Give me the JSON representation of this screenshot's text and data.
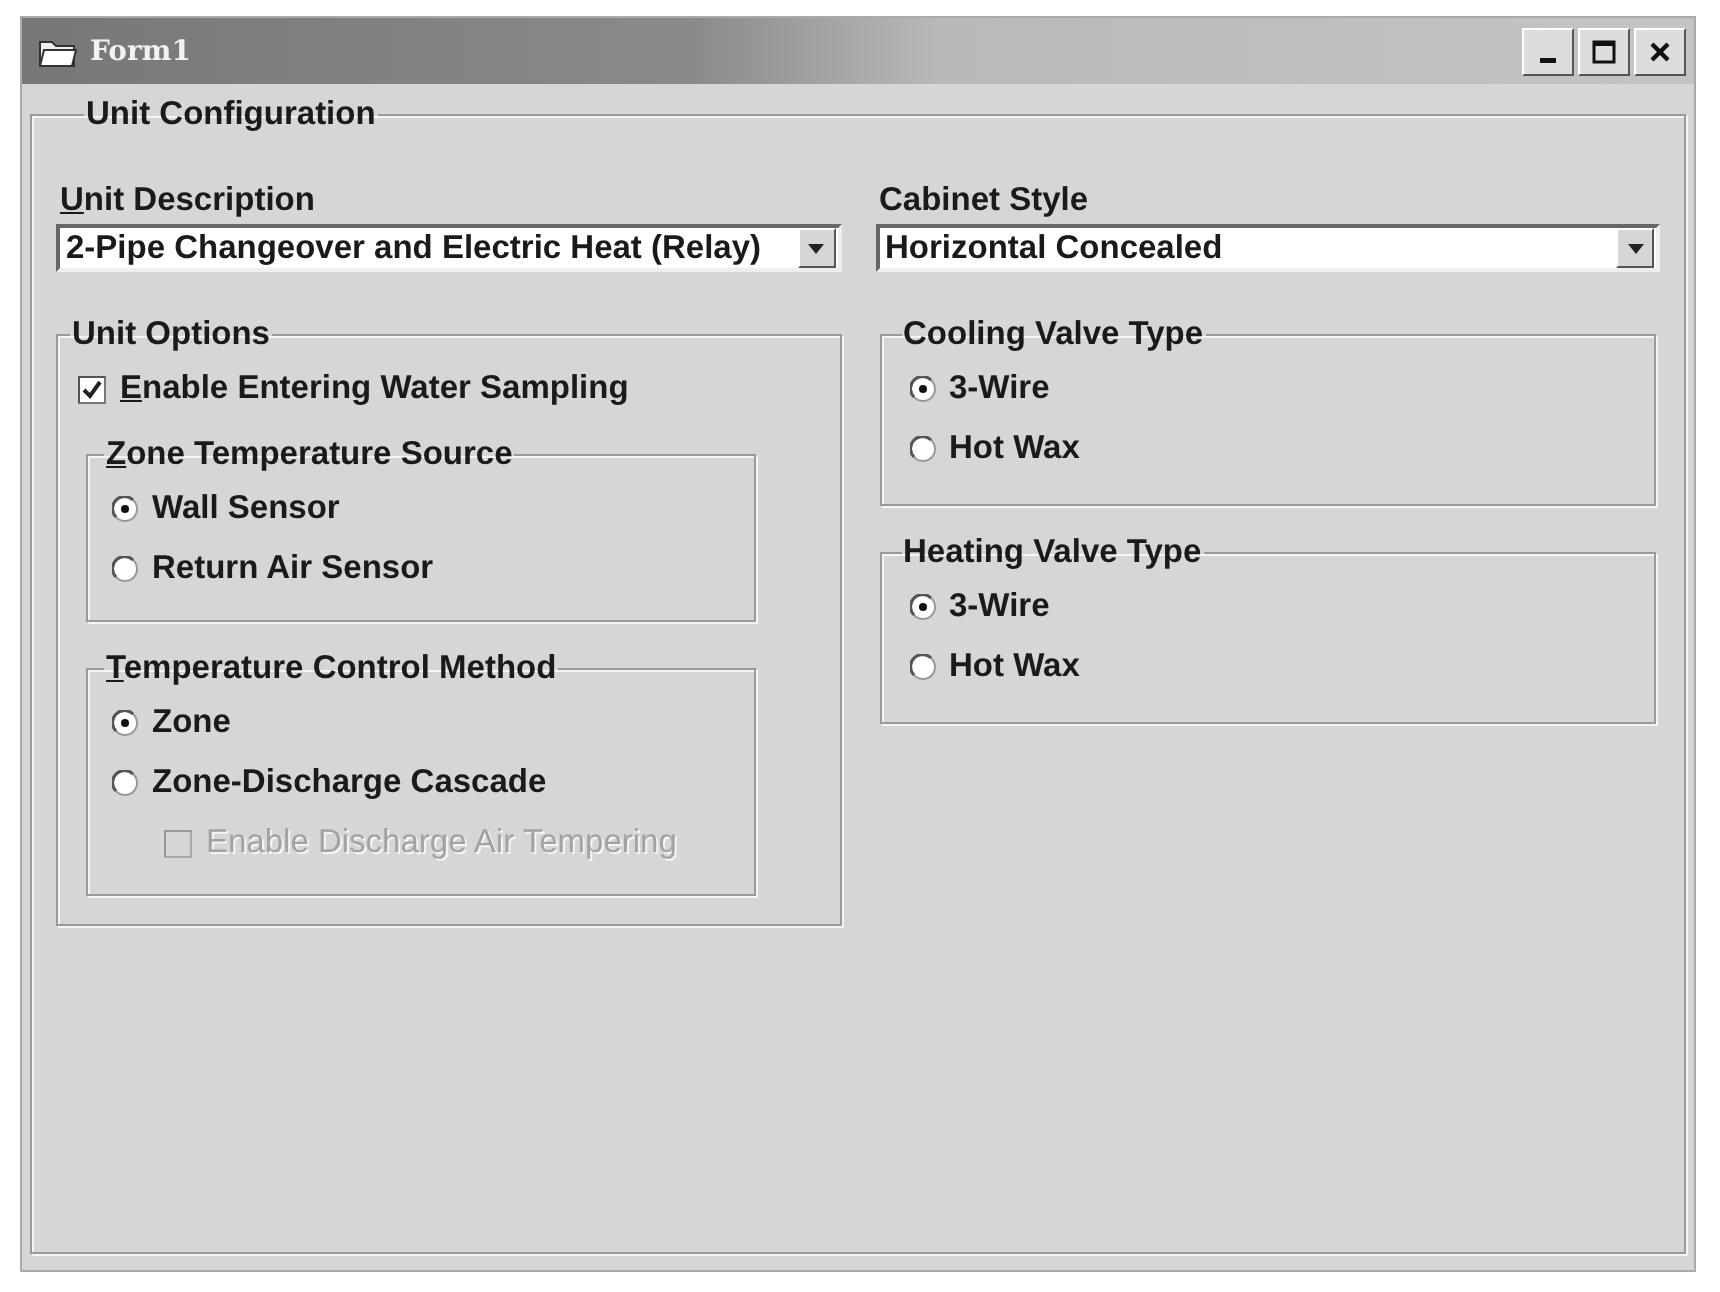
{
  "window": {
    "title": "Form1"
  },
  "configuration": {
    "title": "Unit Configuration",
    "unit_description": {
      "label": "Unit Description",
      "mnemonic": true,
      "value": "2-Pipe Changeover and Electric Heat (Relay)"
    },
    "cabinet_style": {
      "label": "Cabinet Style",
      "mnemonic": false,
      "value": "Horizontal Concealed"
    },
    "unit_options": {
      "title": "Unit Options",
      "checkbox": {
        "label": "Enable Entering Water Sampling",
        "mnemonic": true,
        "checked": true,
        "disabled": false
      },
      "groups": [
        {
          "title": "Zone Temperature Source",
          "mnemonic": true,
          "options": [
            {
              "kind": "radio",
              "label": "Wall Sensor",
              "selected": true
            },
            {
              "kind": "radio",
              "label": "Return Air Sensor",
              "selected": false
            }
          ]
        },
        {
          "title": "Temperature Control Method",
          "mnemonic": true,
          "options": [
            {
              "kind": "radio",
              "label": "Zone",
              "selected": true
            },
            {
              "kind": "radio",
              "label": "Zone-Discharge Cascade",
              "selected": false
            },
            {
              "kind": "checkbox",
              "label": "Enable Discharge Air Tempering",
              "checked": false,
              "disabled": true
            }
          ]
        }
      ]
    },
    "valve_groups": [
      {
        "title": "Cooling Valve Type",
        "mnemonic": false,
        "options": [
          {
            "kind": "radio",
            "label": "3-Wire",
            "selected": true
          },
          {
            "kind": "radio",
            "label": "Hot Wax",
            "selected": false
          }
        ]
      },
      {
        "title": "Heating Valve Type",
        "mnemonic": false,
        "options": [
          {
            "kind": "radio",
            "label": "3-Wire",
            "selected": true
          },
          {
            "kind": "radio",
            "label": "Hot Wax",
            "selected": false
          }
        ]
      }
    ]
  }
}
